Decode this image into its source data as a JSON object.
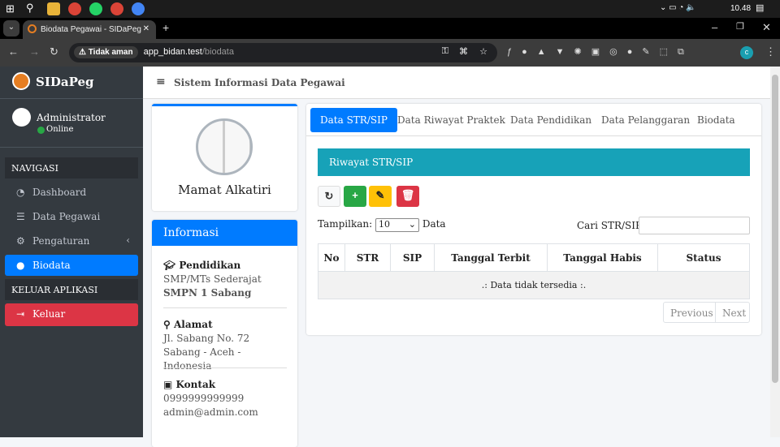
{
  "taskbar": {
    "time": "10.48"
  },
  "browser": {
    "tab_title": "Biodata Pegawai - SIDaPeg",
    "security": "Tidak aman",
    "url_host": "app_bidan.test",
    "url_path": "/biodata",
    "profile_initial": "c"
  },
  "sidebar": {
    "brand": "SIDaPeg",
    "user": "Administrator",
    "status": "Online",
    "nav_heading": "NAVIGASI",
    "items": [
      {
        "label": "Dashboard"
      },
      {
        "label": "Data Pegawai"
      },
      {
        "label": "Pengaturan"
      },
      {
        "label": "Biodata"
      }
    ],
    "exit_heading": "KELUAR APLIKASI",
    "logout": "Keluar"
  },
  "header": {
    "title": "Sistem Informasi Data Pegawai"
  },
  "profile": {
    "name": "Mamat Alkatiri"
  },
  "info": {
    "title": "Informasi",
    "education_label": "Pendidikan",
    "education_level": "SMP/MTs Sederajat",
    "education_school": "SMPN 1 Sabang",
    "address_label": "Alamat",
    "address": "Jl. Sabang No. 72 Sabang - Aceh - Indonesia",
    "contact_label": "Kontak",
    "phone": "0999999999999",
    "email": "admin@admin.com"
  },
  "main": {
    "tabs": [
      "Data STR/SIP",
      "Data Riwayat Praktek",
      "Data Pendidikan",
      "Data Pelanggaran",
      "Biodata"
    ],
    "section_title": "Riwayat STR/SIP",
    "show_label": "Tampilkan:",
    "show_value": "10",
    "data_label": "Data",
    "search_label": "Cari STR/SIP:",
    "columns": [
      "No",
      "STR",
      "SIP",
      "Tanggal Terbit",
      "Tanggal Habis",
      "Status"
    ],
    "empty": ".: Data tidak tersedia :.",
    "prev": "Previous",
    "next": "Next"
  },
  "colors": {
    "primary": "#007bff",
    "success": "#28a745",
    "warning": "#ffc107",
    "danger": "#dc3545",
    "info": "#17a2b8"
  }
}
